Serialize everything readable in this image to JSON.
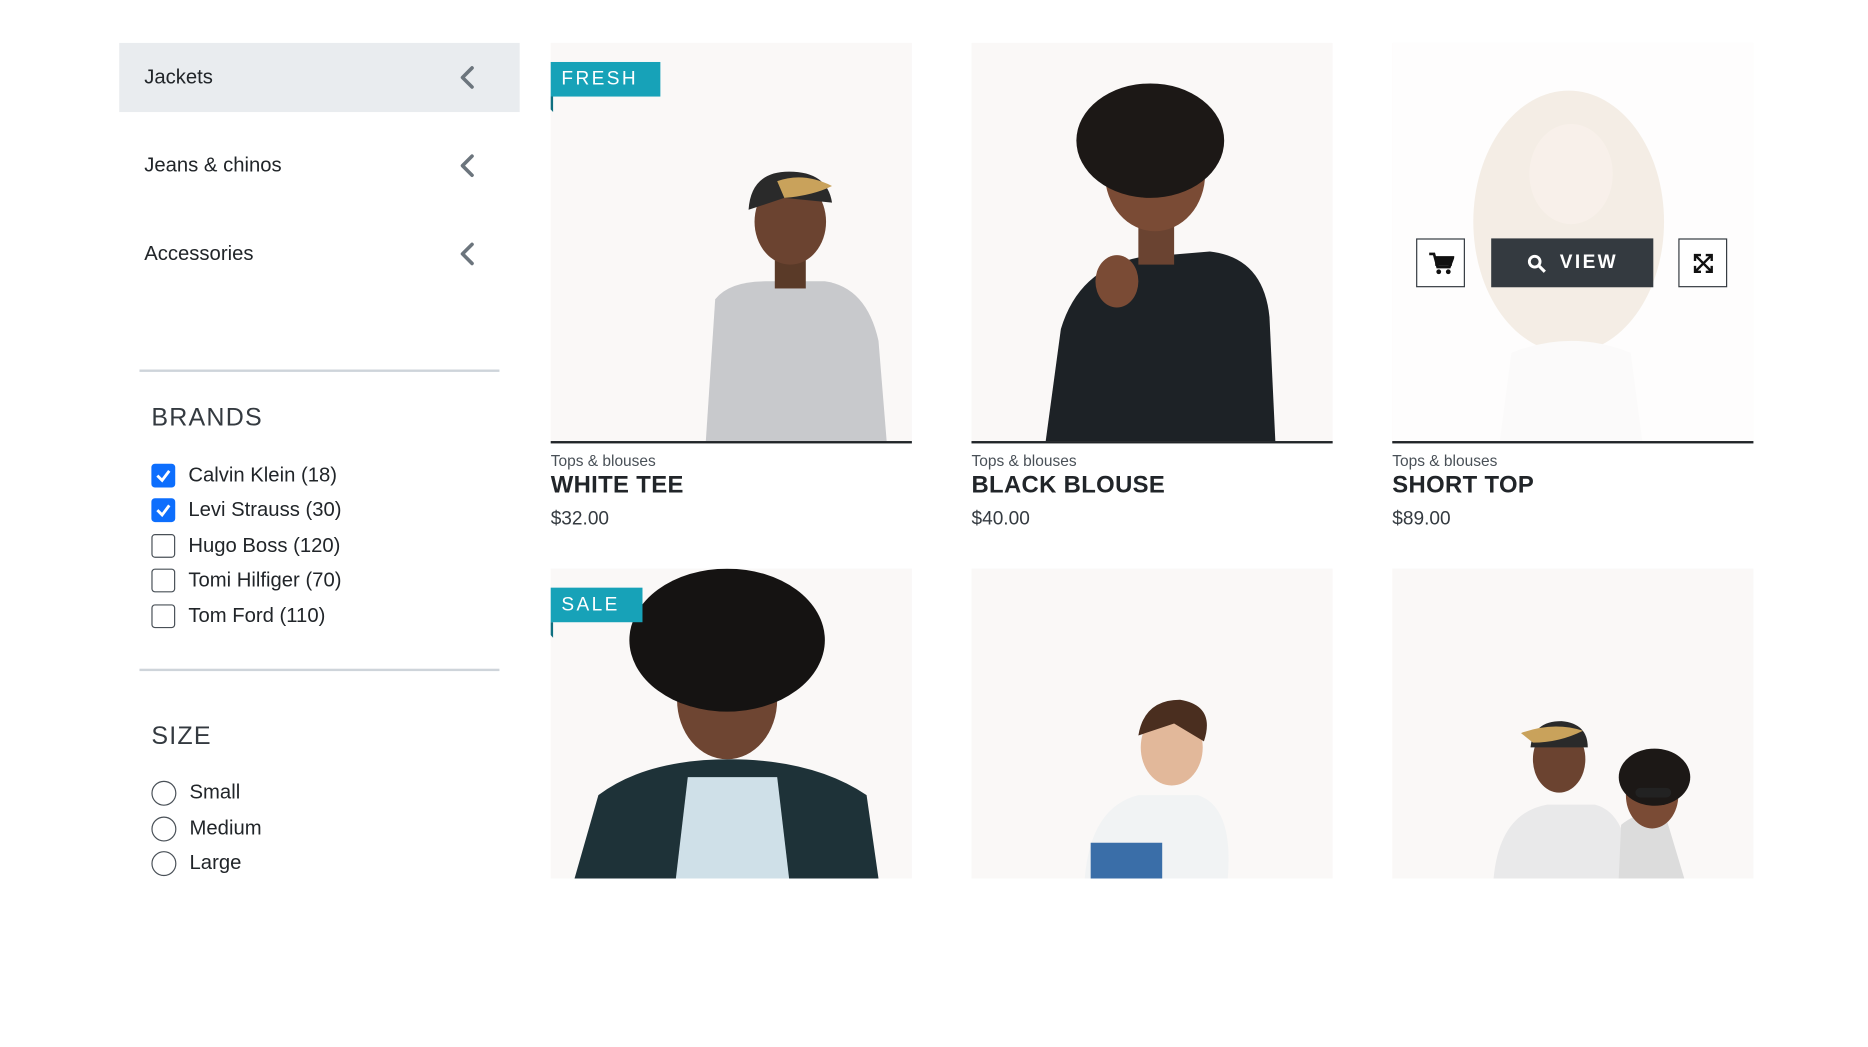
{
  "sidebar": {
    "categories": [
      {
        "label": "Jackets"
      },
      {
        "label": "Jeans & chinos"
      },
      {
        "label": "Accessories"
      }
    ],
    "brands": {
      "title": "BRANDS",
      "items": [
        {
          "label": "Calvin Klein (18)",
          "checked": true
        },
        {
          "label": "Levi Strauss (30)",
          "checked": true
        },
        {
          "label": "Hugo Boss (120)",
          "checked": false
        },
        {
          "label": "Tomi Hilfiger (70)",
          "checked": false
        },
        {
          "label": "Tom Ford (110)",
          "checked": false
        }
      ]
    },
    "size": {
      "title": "SIZE",
      "items": [
        {
          "label": "Small"
        },
        {
          "label": "Medium"
        },
        {
          "label": "Large"
        }
      ]
    }
  },
  "products": [
    {
      "ribbon": "FRESH",
      "category": "Tops & blouses",
      "name": "WHITE TEE",
      "price": "$32.00"
    },
    {
      "category": "Tops & blouses",
      "name": "BLACK BLOUSE",
      "price": "$40.00"
    },
    {
      "category": "Tops & blouses",
      "name": "SHORT TOP",
      "price": "$89.00",
      "overlay": {
        "view_label": "VIEW"
      }
    },
    {
      "ribbon": "SALE"
    },
    {},
    {}
  ],
  "colors": {
    "accent": "#17a2b8",
    "active_bg": "#e9ecef",
    "checkbox": "#0d6efd",
    "dark": "#343a40"
  }
}
